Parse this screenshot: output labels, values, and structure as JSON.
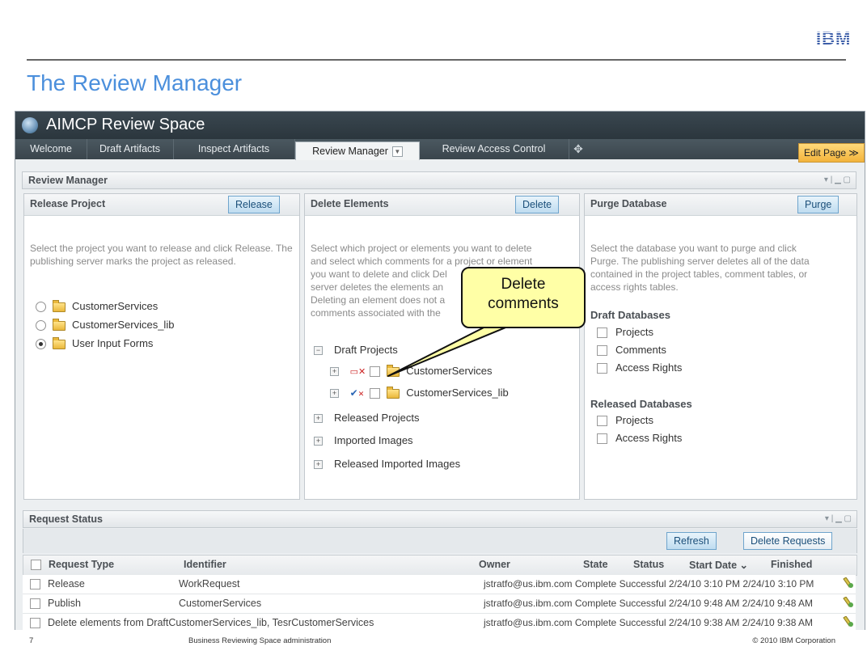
{
  "slide": {
    "logo": "IBM",
    "title": "The Review Manager",
    "footer": {
      "page": "7",
      "center": "Business Reviewing Space administration",
      "copyright": "© 2010 IBM Corporation"
    }
  },
  "app": {
    "title": "AIMCP Review Space",
    "tabs": [
      "Welcome",
      "Draft Artifacts",
      "Inspect Artifacts",
      "Review Manager",
      "Review Access Control"
    ],
    "edit_page": "Edit Page ≫"
  },
  "review_manager": {
    "title": "Review Manager",
    "release": {
      "title": "Release Project",
      "button": "Release",
      "description": "Select the project you want to release and click Release. The publishing server marks the project as released.",
      "projects": [
        "CustomerServices",
        "CustomerServices_lib",
        "User Input Forms"
      ]
    },
    "delete": {
      "title": "Delete Elements",
      "button": "Delete",
      "description_lines": [
        "Select which project or elements you want to delete",
        "and select which comments for a project or element",
        "you want to delete and click Del",
        "server deletes the elements an",
        "Deleting an element does not a",
        "comments associated with the"
      ],
      "tree": {
        "draft": "Draft Projects",
        "draft_items": [
          "CustomerServices",
          "CustomerServices_lib"
        ],
        "released": "Released Projects",
        "imported": "Imported Images",
        "released_imported": "Released Imported Images"
      }
    },
    "purge": {
      "title": "Purge Database",
      "button": "Purge",
      "description_lines": [
        "Select the database you want to purge and click",
        "Purge. The publishing server deletes all of the data",
        "contained in the project tables, comment tables, or",
        "access rights tables."
      ],
      "draft_title": "Draft Databases",
      "draft_items": [
        "Projects",
        "Comments",
        "Access Rights"
      ],
      "released_title": "Released Databases",
      "released_items": [
        "Projects",
        "Access Rights"
      ]
    }
  },
  "callout": {
    "line1": "Delete",
    "line2": "comments"
  },
  "request_status": {
    "title": "Request Status",
    "refresh": "Refresh",
    "delete_requests": "Delete Requests",
    "columns": [
      "Request Type",
      "Identifier",
      "Owner",
      "State",
      "Status",
      "Start Date ⌄",
      "Finished"
    ],
    "rows": [
      {
        "type": "Release",
        "identifier": "WorkRequest",
        "tail": "jstratfo@us.ibm.com Complete Successful 2/24/10 3:10 PM 2/24/10 3:10 PM"
      },
      {
        "type": "Publish",
        "identifier": "CustomerServices",
        "tail": "jstratfo@us.ibm.com Complete Successful 2/24/10 9:48 AM 2/24/10 9:48 AM"
      },
      {
        "type": "Delete elements from DraftCustomerServices_lib, TesrCustomerServices",
        "identifier": "",
        "tail": "jstratfo@us.ibm.com Complete Successful 2/24/10 9:38 AM 2/24/10 9:38 AM"
      }
    ]
  }
}
